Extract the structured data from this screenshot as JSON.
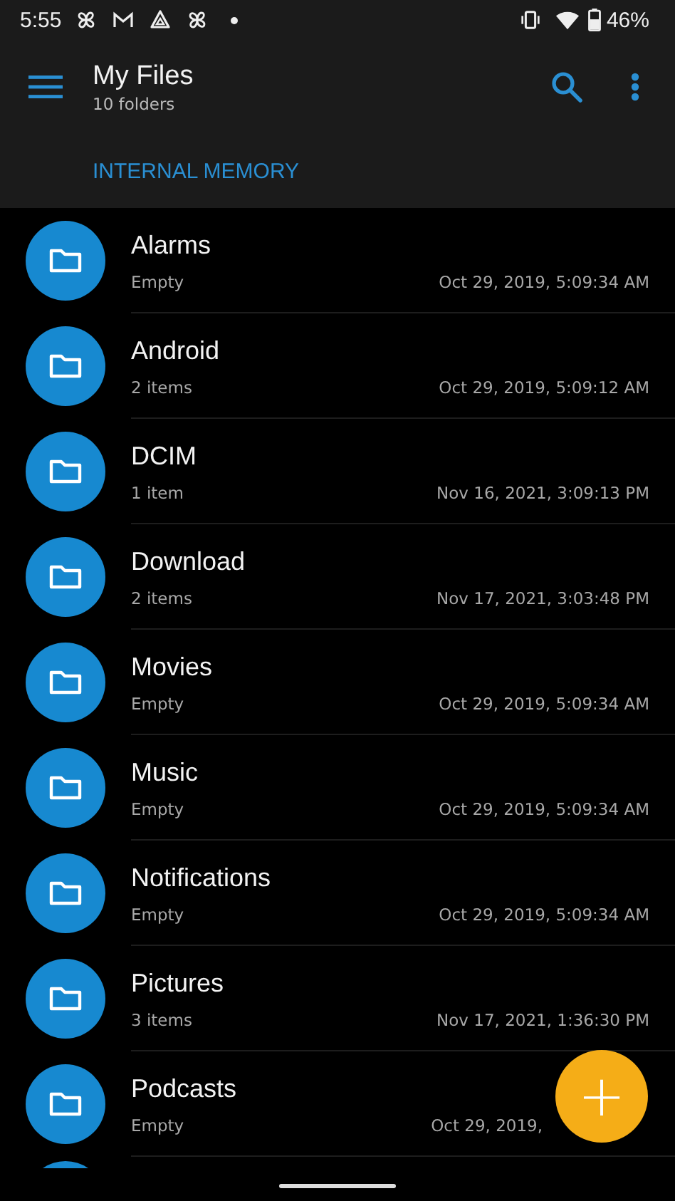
{
  "status_bar": {
    "time": "5:55",
    "battery": "46%"
  },
  "app_bar": {
    "title": "My Files",
    "subtitle": "10 folders"
  },
  "section": "INTERNAL MEMORY",
  "folders": [
    {
      "name": "Alarms",
      "info": "Empty",
      "date": "Oct 29, 2019, 5:09:34 AM"
    },
    {
      "name": "Android",
      "info": "2 items",
      "date": "Oct 29, 2019, 5:09:12 AM"
    },
    {
      "name": "DCIM",
      "info": "1 item",
      "date": "Nov 16, 2021, 3:09:13 PM"
    },
    {
      "name": "Download",
      "info": "2 items",
      "date": "Nov 17, 2021, 3:03:48 PM"
    },
    {
      "name": "Movies",
      "info": "Empty",
      "date": "Oct 29, 2019, 5:09:34 AM"
    },
    {
      "name": "Music",
      "info": "Empty",
      "date": "Oct 29, 2019, 5:09:34 AM"
    },
    {
      "name": "Notifications",
      "info": "Empty",
      "date": "Oct 29, 2019, 5:09:34 AM"
    },
    {
      "name": "Pictures",
      "info": "3 items",
      "date": "Nov 17, 2021, 1:36:30 PM"
    },
    {
      "name": "Podcasts",
      "info": "Empty",
      "date": "Oct 29, 2019,"
    }
  ],
  "fab": "+"
}
